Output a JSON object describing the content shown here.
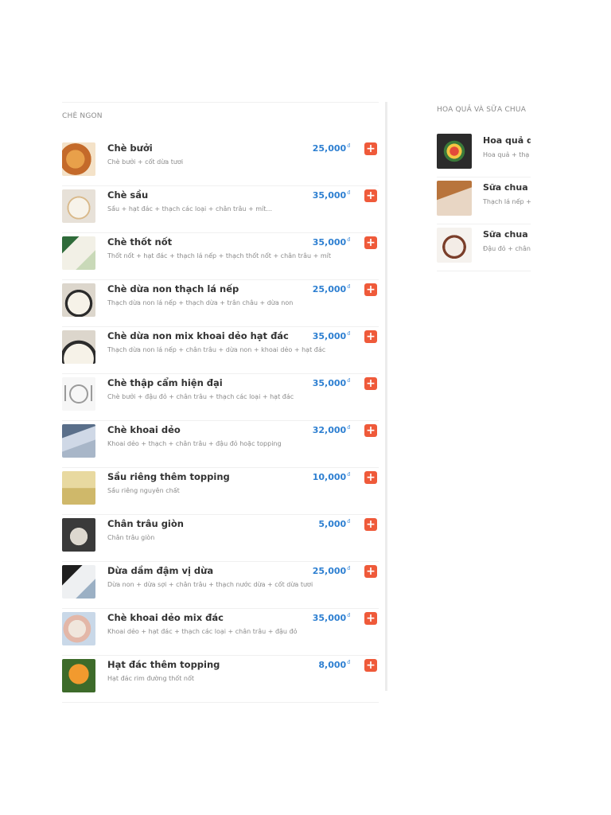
{
  "left_section": {
    "title": "CHÈ NGON",
    "items": [
      {
        "name": "Chè bưởi",
        "desc": "Chè bưởi + cốt dừa tươi",
        "price": "25,000",
        "currency": "đ",
        "image": "che-buoi-photo"
      },
      {
        "name": "Chè sầu",
        "desc": "Sầu + hạt đác + thạch các loại + chân trâu + mít...",
        "price": "35,000",
        "currency": "đ",
        "image": "che-sau-photo"
      },
      {
        "name": "Chè thốt nốt",
        "desc": "Thốt nốt + hạt đác + thạch lá nếp + thạch thốt nốt + chân trâu + mít",
        "price": "35,000",
        "currency": "đ",
        "image": "che-thot-not-photo"
      },
      {
        "name": "Chè dừa non thạch lá nếp",
        "desc": "Thạch dừa non lá nếp + thạch dừa + trân châu + dừa non",
        "price": "25,000",
        "currency": "đ",
        "image": "che-dua-non-photo"
      },
      {
        "name": "Chè dừa non mix khoai dẻo hạt đác",
        "desc": "Thạch dừa non lá nếp + chân trâu + dừa non + khoai dẻo + hạt đác",
        "price": "35,000",
        "currency": "đ",
        "image": "che-dua-non-mix-photo"
      },
      {
        "name": "Chè thập cẩm hiện đại",
        "desc": "Chè bưởi + đậu đỏ + chân trâu + thạch các loại + hạt đác",
        "price": "35,000",
        "currency": "đ",
        "image": "plate-placeholder-icon"
      },
      {
        "name": "Chè khoai dẻo",
        "desc": "Khoai dẻo + thạch + chân trâu + đậu đỏ hoặc topping",
        "price": "32,000",
        "currency": "đ",
        "image": "che-khoai-deo-photo"
      },
      {
        "name": "Sầu riêng thêm topping",
        "desc": "Sầu riêng nguyên chất",
        "price": "10,000",
        "currency": "đ",
        "image": "sau-rieng-photo"
      },
      {
        "name": "Chân trâu giòn",
        "desc": "Chân trâu giòn",
        "price": "5,000",
        "currency": "đ",
        "image": "chan-trau-photo"
      },
      {
        "name": "Dừa dầm đậm vị dừa",
        "desc": "Dừa non + dừa sợi + chân trâu + thạch nước dừa + cốt dừa tươi",
        "price": "25,000",
        "currency": "đ",
        "image": "dua-dam-photo"
      },
      {
        "name": "Chè khoai dẻo mix đác",
        "desc": "Khoai dẻo + hạt đác + thạch các loại + chân trâu + đậu đỏ",
        "price": "35,000",
        "currency": "đ",
        "image": "che-khoai-dac-photo"
      },
      {
        "name": "Hạt đác thêm topping",
        "desc": "Hạt đác rim đường thốt nốt",
        "price": "8,000",
        "currency": "đ",
        "image": "hat-dac-photo"
      }
    ],
    "add_label": "+"
  },
  "right_section": {
    "title": "HOA QUẢ VÀ SỮA CHUA",
    "items": [
      {
        "name": "Hoa quả dầ",
        "desc": "Hoa quả + thạ",
        "image": "hoa-qua-photo"
      },
      {
        "name": "Sữa chua t",
        "desc": "Thạch lá nếp +",
        "image": "sua-chua-photo"
      },
      {
        "name": "Sữa chua đ",
        "desc": "Đậu đỏ + chân",
        "image": "sua-chua-dau-photo"
      }
    ]
  },
  "colors": {
    "price": "#2d7fd1",
    "add_button": "#ef5a3a",
    "title_text": "#333333",
    "muted_text": "#8a8a8a"
  }
}
